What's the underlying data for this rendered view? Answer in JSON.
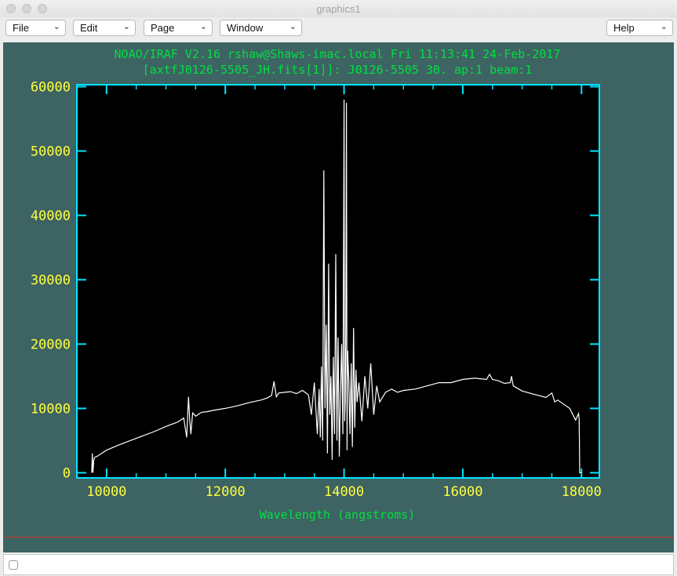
{
  "window": {
    "title": "graphics1"
  },
  "menus": [
    {
      "label": "File"
    },
    {
      "label": "Edit"
    },
    {
      "label": "Page"
    },
    {
      "label": "Window"
    },
    {
      "label": "Help"
    }
  ],
  "colors": {
    "canvas_bg": "#3d6363",
    "frame": "#00e5ff",
    "title_text": "#00e040",
    "tick_text": "#ffff40",
    "line": "#ffffff"
  },
  "chart_data": {
    "type": "line",
    "title_line1": "NOAO/IRAF V2.16 rshaw@Shaws-imac.local Fri 11:13:41 24-Feb-2017",
    "title_line2": "[axtfJ0126-5505_JH.fits[1]]: J0126-5505 30. ap:1 beam:1",
    "xlabel": "Wavelength (angstroms)",
    "ylabel": "",
    "xlim": [
      9500,
      18300
    ],
    "ylim": [
      -800,
      60300
    ],
    "xticks": [
      "10000",
      "12000",
      "14000",
      "16000",
      "18000"
    ],
    "yticks": [
      "0",
      "10000",
      "20000",
      "30000",
      "40000",
      "50000",
      "60000"
    ],
    "grid": false,
    "series": [
      {
        "x": [
          9750,
          9760,
          9770,
          9785,
          9800,
          9850,
          10000,
          10200,
          10400,
          10600,
          10800,
          11000,
          11200,
          11300,
          11350,
          11380,
          11400,
          11420,
          11450,
          11500,
          11600,
          11700,
          11800,
          12000,
          12200,
          12400,
          12600,
          12700,
          12780,
          12820,
          12860,
          12900,
          13000,
          13100,
          13200,
          13300,
          13400,
          13450,
          13500,
          13550,
          13580,
          13600,
          13620,
          13640,
          13660,
          13680,
          13700,
          13720,
          13740,
          13760,
          13780,
          13800,
          13820,
          13840,
          13860,
          13880,
          13900,
          13920,
          13940,
          13960,
          13980,
          14000,
          14010,
          14020,
          14030,
          14040,
          14050,
          14060,
          14080,
          14100,
          14120,
          14140,
          14160,
          14180,
          14200,
          14220,
          14250,
          14300,
          14350,
          14400,
          14450,
          14500,
          14550,
          14600,
          14700,
          14800,
          14900,
          15000,
          15200,
          15400,
          15600,
          15800,
          16000,
          16200,
          16400,
          16450,
          16500,
          16600,
          16700,
          16800,
          16820,
          16850,
          17000,
          17200,
          17400,
          17500,
          17550,
          17600,
          17800,
          17900,
          17950,
          17960,
          17970,
          18000
        ],
        "y": [
          0,
          3000,
          0,
          2000,
          2400,
          2600,
          3500,
          4300,
          5000,
          5700,
          6400,
          7200,
          7900,
          8500,
          5500,
          11800,
          8300,
          6000,
          9300,
          8800,
          9400,
          9500,
          9700,
          10000,
          10400,
          10900,
          11300,
          11600,
          12000,
          14200,
          11800,
          12400,
          12500,
          12600,
          12300,
          12800,
          12100,
          9000,
          14000,
          6000,
          13000,
          5500,
          16500,
          5000,
          47000,
          10000,
          23000,
          3000,
          32500,
          9000,
          15000,
          2000,
          18000,
          6000,
          34000,
          5000,
          21000,
          2500,
          12000,
          20000,
          6000,
          58000,
          8000,
          11000,
          22000,
          57500,
          3500,
          19000,
          14500,
          6000,
          17000,
          4000,
          22500,
          7000,
          16000,
          11000,
          14000,
          8000,
          15000,
          10000,
          17000,
          9000,
          13500,
          11000,
          12500,
          13000,
          12500,
          12800,
          13000,
          13500,
          14000,
          14000,
          14500,
          14700,
          14500,
          15300,
          14500,
          14300,
          13900,
          14000,
          15000,
          13500,
          12700,
          12200,
          11700,
          12400,
          11000,
          11300,
          10000,
          8200,
          9200,
          8300,
          0,
          0
        ]
      }
    ]
  }
}
